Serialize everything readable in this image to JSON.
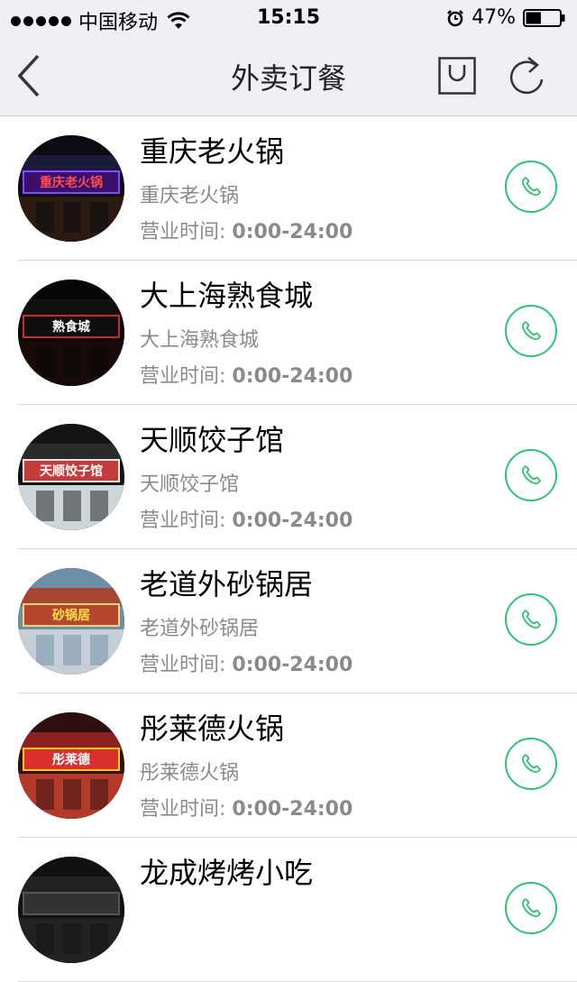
{
  "status_bar": {
    "carrier": "中国移动",
    "time": "15:15",
    "battery": "47%",
    "battery_level": 0.47
  },
  "nav": {
    "title": "外卖订餐",
    "back_icon": "back-chevron-icon",
    "cart_icon": "cart-icon",
    "refresh_icon": "refresh-icon"
  },
  "restaurants": [
    {
      "name": "重庆老火锅",
      "subname": "重庆老火锅",
      "hours_label": "营业时间:",
      "hours": "0:00-24:00",
      "sign_text": "重庆老火锅"
    },
    {
      "name": "大上海熟食城",
      "subname": "大上海熟食城",
      "hours_label": "营业时间:",
      "hours": "0:00-24:00",
      "sign_text": "熟食城"
    },
    {
      "name": "天顺饺子馆",
      "subname": "天顺饺子馆",
      "hours_label": "营业时间:",
      "hours": "0:00-24:00",
      "sign_text": "天顺饺子馆"
    },
    {
      "name": "老道外砂锅居",
      "subname": "老道外砂锅居",
      "hours_label": "营业时间:",
      "hours": "0:00-24:00",
      "sign_text": "砂锅居"
    },
    {
      "name": "彤莱德火锅",
      "subname": "彤莱德火锅",
      "hours_label": "营业时间:",
      "hours": "0:00-24:00",
      "sign_text": "彤莱德"
    },
    {
      "name": "龙成烤烤小吃",
      "subname": "",
      "hours_label": "",
      "hours": "",
      "sign_text": ""
    }
  ],
  "colors": {
    "accent": "#2ec474",
    "nav_bg": "#efeff4",
    "secondary_text": "#8a8a8a"
  }
}
